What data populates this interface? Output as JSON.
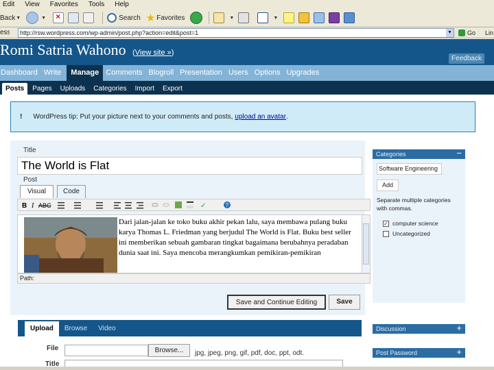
{
  "browser": {
    "menu": [
      "Edit",
      "View",
      "Favorites",
      "Tools",
      "Help"
    ],
    "toolbar": {
      "back_label": "Back",
      "search_label": "Search",
      "favorites_label": "Favorites"
    },
    "address": {
      "label": "ess",
      "url": "http://rsw.wordpress.com/wp-admin/post.php?action=edit&post=1",
      "go_label": "Go",
      "links_label": "Lin"
    }
  },
  "wp": {
    "blog_title": "Romi Satria Wahono",
    "view_site_open": "(",
    "view_site_label": "View site »",
    "view_site_close": ")",
    "feedback_label": "Feedback",
    "main_nav": [
      "Dashboard",
      "Write",
      "Manage",
      "Comments",
      "Blogroll",
      "Presentation",
      "Users",
      "Options",
      "Upgrades"
    ],
    "sub_nav": [
      "Posts",
      "Pages",
      "Uploads",
      "Categories",
      "Import",
      "Export"
    ],
    "tip": {
      "bang": "!",
      "text": "WordPress tip: Put your picture next to your comments and posts,",
      "link": "upload an avatar",
      "tail": "."
    },
    "post": {
      "title_label": "Title",
      "title_value": "The World is Flat",
      "post_label": "Post",
      "tab_visual": "Visual",
      "tab_code": "Code",
      "body_text": "Dari jalan-jalan ke toko buku akhir pekan lalu, saya membawa pulang buku karya Thomas L. Friedman yang berjudul The World is Flat. Buku best seller ini memberikan sebuah gambaran tingkat bagaimana berubahnya peradaban dunia saat ini. Saya mencoba merangkumkan pemikiran-pemikiran",
      "path_label": "Path:",
      "save_continue_label": "Save and Continue Editing",
      "save_label": "Save"
    },
    "upload": {
      "tabs": [
        "Upload",
        "Browse",
        "Video"
      ],
      "file_label": "File",
      "browse_label": "Browse...",
      "file_types": "jpg, jpeg, png, gif, pdf, doc, ppt, odt.",
      "title_label": "Title"
    },
    "sidebar": {
      "categories_label": "Categories",
      "collapse_glyph": "−",
      "expand_glyph": "+",
      "new_category_value": "Software Engineering",
      "add_label": "Add",
      "separate_hint": "Separate multiple categories with commas.",
      "categories": [
        {
          "label": "computer science",
          "checked": true
        },
        {
          "label": "Uncategorized",
          "checked": false
        }
      ],
      "discussion_label": "Discussion",
      "post_password_label": "Post Password"
    }
  },
  "colors": {
    "header_blue": "#14568a",
    "nav_light": "#83b4d8",
    "nav_dark": "#0d324f",
    "tip_bg": "#cfebf7"
  }
}
